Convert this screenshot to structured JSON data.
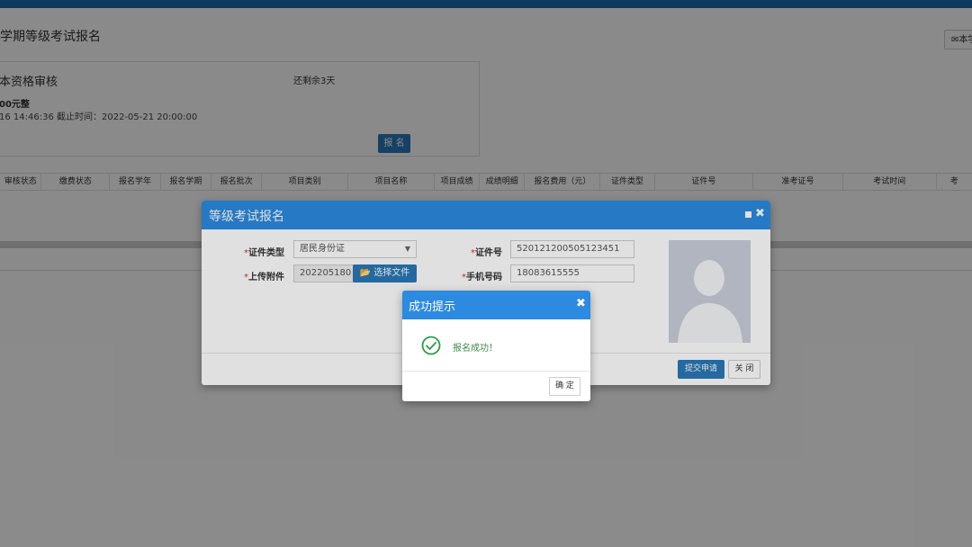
{
  "page": {
    "title": "学期等级考试报名",
    "top_right_button": "本学"
  },
  "card": {
    "title": "本资格审核",
    "remaining": "还剩余3天",
    "fee": "00元整",
    "time_info": "16 14:46:36 截止时间：2022-05-21 20:00:00",
    "apply_button": "报 名"
  },
  "table": {
    "headers": [
      "审核状态",
      "缴费状态",
      "报名学年",
      "报名学期",
      "报名批次",
      "项目类别",
      "项目名称",
      "项目成绩",
      "成绩明细",
      "报名费用（元）",
      "证件类型",
      "证件号",
      "准考证号",
      "考试时间",
      "考"
    ]
  },
  "dialog": {
    "title": "等级考试报名",
    "id_type_label": "证件类型",
    "id_type_value": "居民身份证",
    "id_number_label": "证件号",
    "id_number_value": "520121200505123451",
    "upload_label": "上传附件",
    "upload_value": "202205180",
    "choose_file_button": "选择文件",
    "phone_label": "手机号码",
    "phone_value": "18083615555",
    "submit_button": "提交申请",
    "close_button": "关 闭"
  },
  "success": {
    "title": "成功提示",
    "message": "报名成功！",
    "ok_button": "确 定"
  },
  "colors": {
    "header_blue": "#2c8ae0",
    "button_blue": "#2b78b8",
    "top_bar": "#1a6db0",
    "success_green": "#3a8a4a",
    "required_red": "#e02b2b"
  }
}
